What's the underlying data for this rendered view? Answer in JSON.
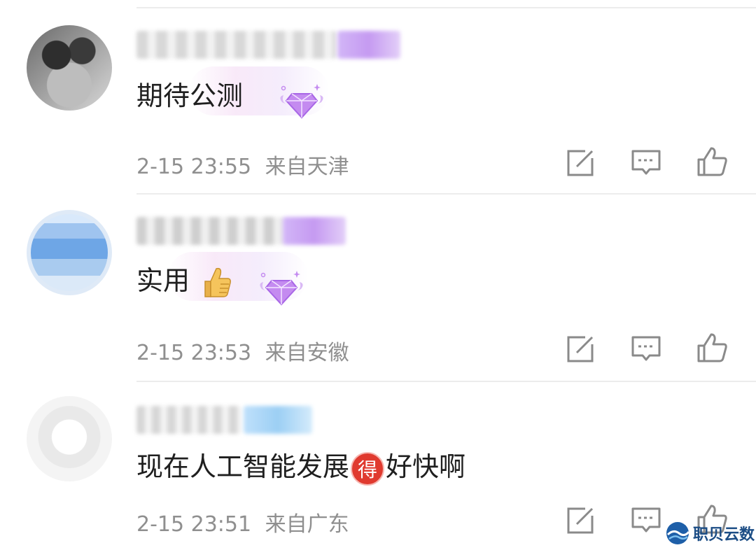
{
  "comments": [
    {
      "text": "期待公测",
      "time": "2-15 23:55",
      "location": "来自天津"
    },
    {
      "text": "实用",
      "time": "2-15 23:53",
      "location": "来自安徽"
    },
    {
      "text_before": "现在人工智能发展",
      "inline_badge": "得",
      "text_after": "好快啊",
      "time": "2-15 23:51",
      "location": "来自广东"
    }
  ],
  "actions": {
    "share_icon": "share-edit-icon",
    "reply_icon": "comment-bubble-icon",
    "like_icon": "thumbs-up-icon"
  },
  "watermark": {
    "text": "职贝云数"
  },
  "colors": {
    "text": "#1f1f1f",
    "meta": "#8f8f8f",
    "divider": "#ececec",
    "badge_purple": "#c59af1",
    "badge_red": "#e03a2f"
  }
}
